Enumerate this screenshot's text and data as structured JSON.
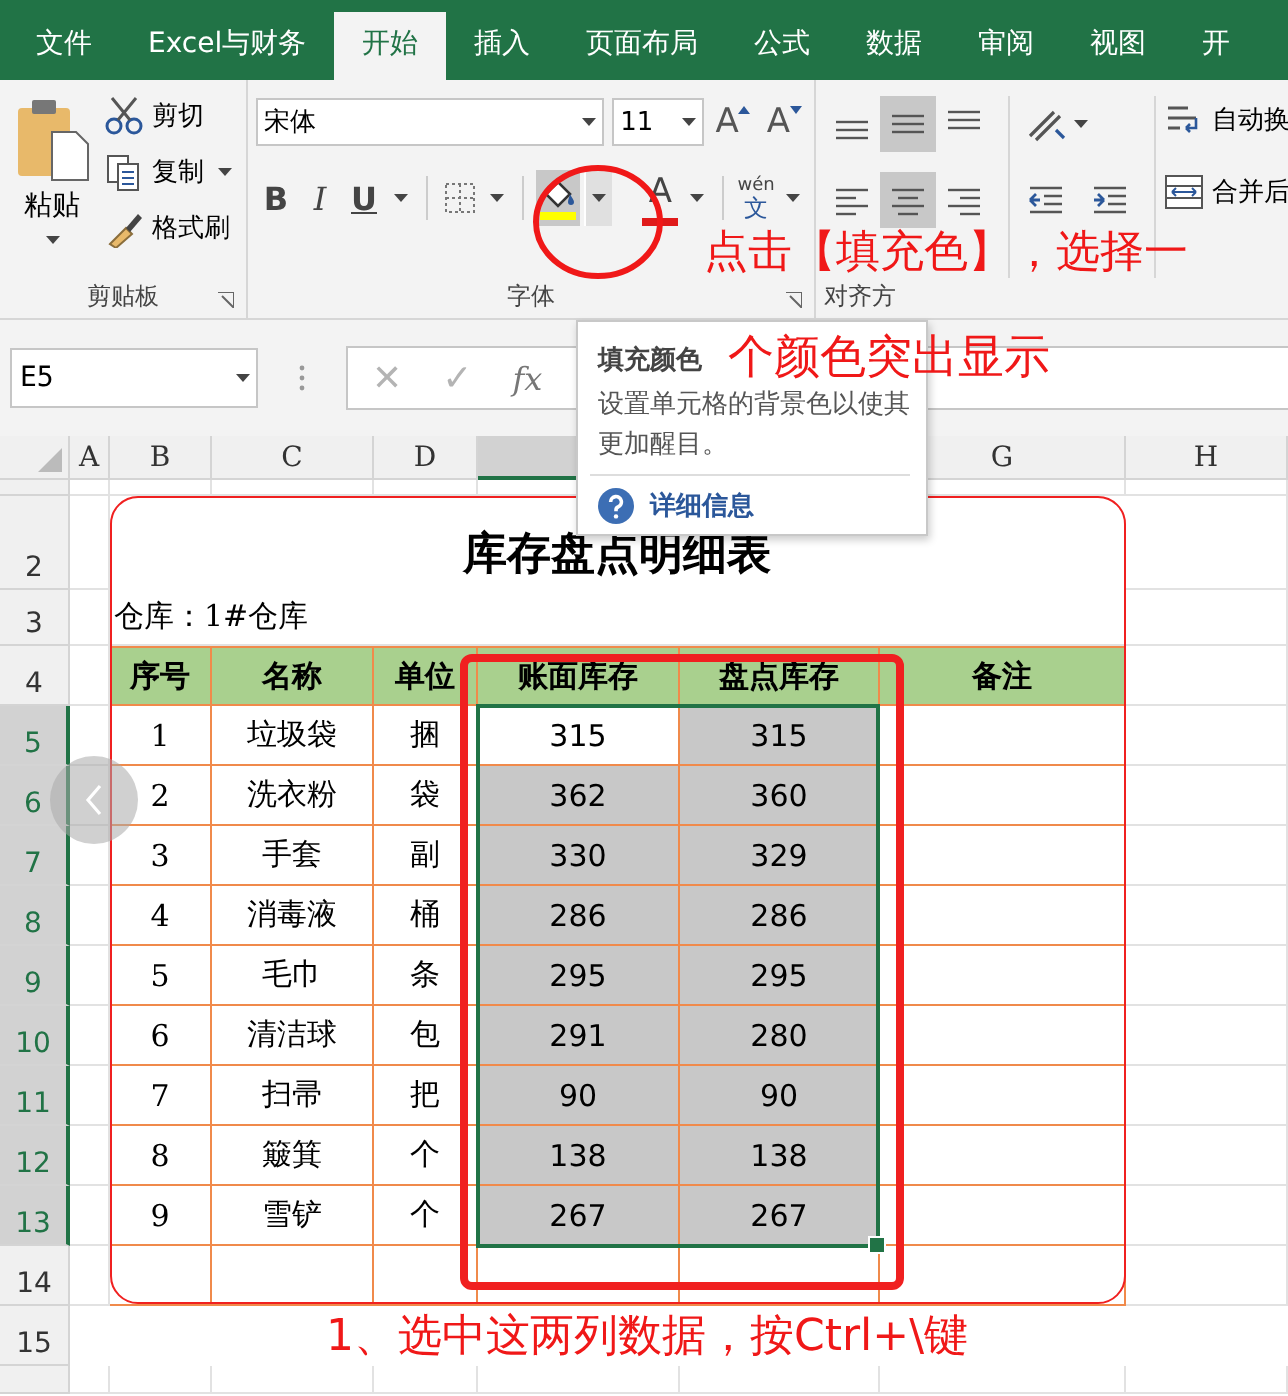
{
  "ribbon_tabs": [
    {
      "label": "文件",
      "selected": false
    },
    {
      "label": "Excel与财务",
      "selected": false
    },
    {
      "label": "开始",
      "selected": true
    },
    {
      "label": "插入",
      "selected": false
    },
    {
      "label": "页面布局",
      "selected": false
    },
    {
      "label": "公式",
      "selected": false
    },
    {
      "label": "数据",
      "selected": false
    },
    {
      "label": "审阅",
      "selected": false
    },
    {
      "label": "视图",
      "selected": false
    },
    {
      "label": "开",
      "selected": false
    }
  ],
  "clipboard": {
    "paste": "粘贴",
    "cut": "剪切",
    "copy": "复制",
    "format_painter": "格式刷",
    "label": "剪贴板"
  },
  "font": {
    "name": "宋体",
    "size": "11",
    "grow": "A",
    "shrink": "A",
    "bold": "B",
    "italic": "I",
    "underline": "U",
    "font_color": "A",
    "phonetic_top": "wén",
    "phonetic_char": "文",
    "label": "字体"
  },
  "alignment": {
    "vertical": [
      {
        "selected": false
      },
      {
        "selected": true
      },
      {
        "selected": false
      }
    ],
    "horizontal": [
      {
        "selected": false
      },
      {
        "selected": true
      },
      {
        "selected": false
      }
    ],
    "wrap": "自动换",
    "merge": "合并后",
    "label": "对齐方"
  },
  "formula_bar": {
    "name_box": "E5",
    "cancel": "✕",
    "enter": "✓",
    "function": "fx"
  },
  "tooltip": {
    "title": "填充颜色",
    "description": "设置单元格的背景色以使其更加醒目。",
    "link": "详细信息"
  },
  "column_headers": [
    "A",
    "B",
    "C",
    "D",
    "G",
    "H"
  ],
  "row_numbers": [
    {
      "label": "2",
      "selected": false
    },
    {
      "label": "3",
      "selected": false
    },
    {
      "label": "4",
      "selected": false
    },
    {
      "label": "5",
      "selected": true
    },
    {
      "label": "6",
      "selected": true
    },
    {
      "label": "7",
      "selected": true
    },
    {
      "label": "8",
      "selected": true
    },
    {
      "label": "9",
      "selected": true
    },
    {
      "label": "10",
      "selected": true
    },
    {
      "label": "11",
      "selected": true
    },
    {
      "label": "12",
      "selected": true
    },
    {
      "label": "13",
      "selected": true
    },
    {
      "label": "14",
      "selected": false
    },
    {
      "label": "15",
      "selected": false
    }
  ],
  "sheet": {
    "title": "库存盘点明细表",
    "warehouse": "仓库：1#仓库",
    "headers": [
      "序号",
      "名称",
      "单位",
      "账面库存",
      "盘点库存",
      "备注"
    ],
    "rows": [
      {
        "no": "1",
        "name": "垃圾袋",
        "unit": "捆",
        "book": {
          "value": "315",
          "filled": false
        },
        "count": {
          "value": "315",
          "filled": true
        }
      },
      {
        "no": "2",
        "name": "洗衣粉",
        "unit": "袋",
        "book": {
          "value": "362",
          "filled": true
        },
        "count": {
          "value": "360",
          "filled": true
        }
      },
      {
        "no": "3",
        "name": "手套",
        "unit": "副",
        "book": {
          "value": "330",
          "filled": true
        },
        "count": {
          "value": "329",
          "filled": true
        }
      },
      {
        "no": "4",
        "name": "消毒液",
        "unit": "桶",
        "book": {
          "value": "286",
          "filled": true
        },
        "count": {
          "value": "286",
          "filled": true
        }
      },
      {
        "no": "5",
        "name": "毛巾",
        "unit": "条",
        "book": {
          "value": "295",
          "filled": true
        },
        "count": {
          "value": "295",
          "filled": true
        }
      },
      {
        "no": "6",
        "name": "清洁球",
        "unit": "包",
        "book": {
          "value": "291",
          "filled": true
        },
        "count": {
          "value": "280",
          "filled": true
        }
      },
      {
        "no": "7",
        "name": "扫帚",
        "unit": "把",
        "book": {
          "value": "90",
          "filled": true
        },
        "count": {
          "value": "90",
          "filled": true
        }
      },
      {
        "no": "8",
        "name": "簸箕",
        "unit": "个",
        "book": {
          "value": "138",
          "filled": true
        },
        "count": {
          "value": "138",
          "filled": true
        }
      },
      {
        "no": "9",
        "name": "雪铲",
        "unit": "个",
        "book": {
          "value": "267",
          "filled": true
        },
        "count": {
          "value": "267",
          "filled": true
        }
      }
    ]
  },
  "callouts": [
    "点击【填充色】，选择一",
    "个颜色突出显示",
    "1、选中这两列数据，按Ctrl+\\键"
  ]
}
